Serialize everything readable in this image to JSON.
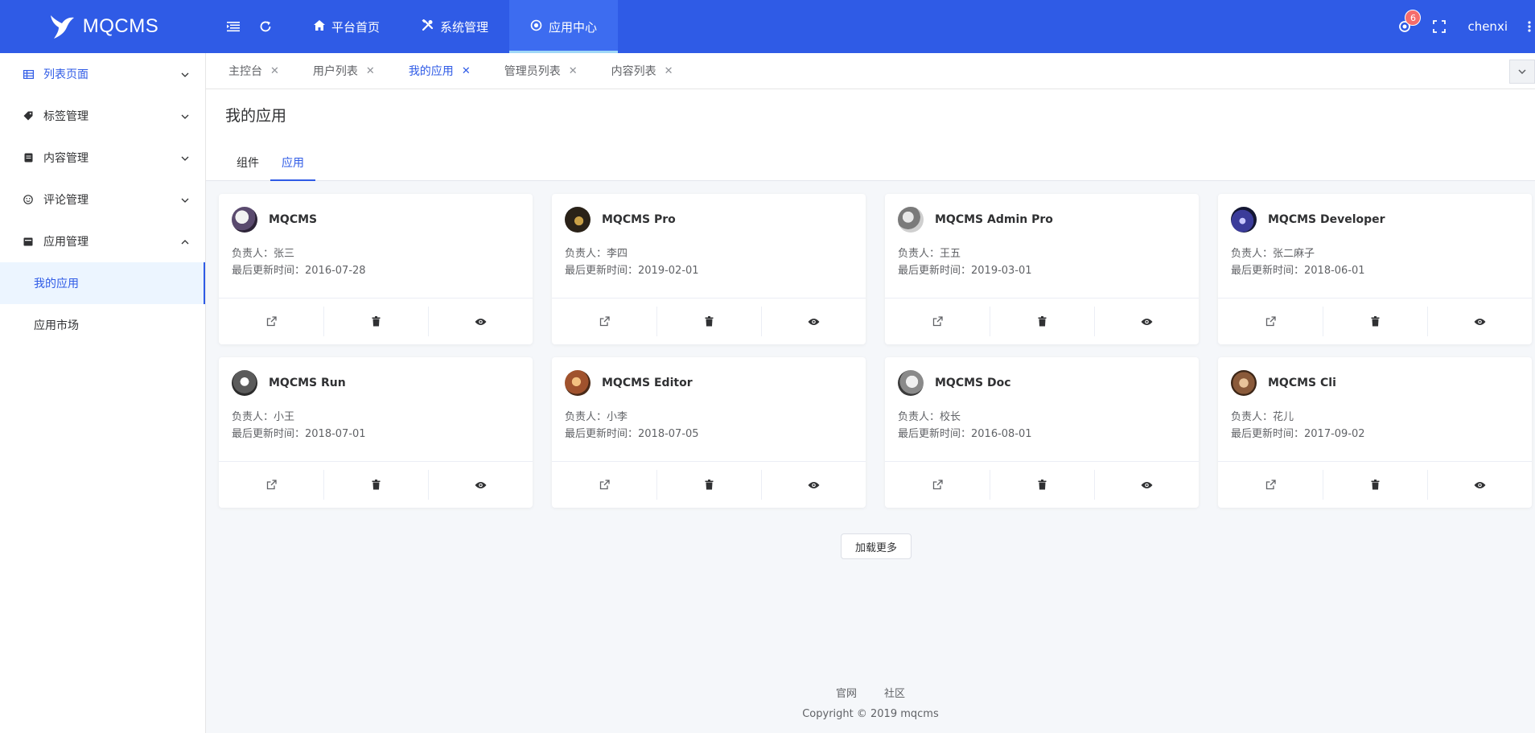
{
  "header": {
    "logo_text": "MQCMS",
    "nav": [
      {
        "label": "平台首页",
        "icon": "home-icon"
      },
      {
        "label": "系统管理",
        "icon": "tools-icon"
      },
      {
        "label": "应用中心",
        "icon": "target-icon",
        "active": true
      }
    ],
    "notification_count": "6",
    "username": "chenxi"
  },
  "sidebar": {
    "items": [
      {
        "label": "列表页面",
        "icon": "table-icon"
      },
      {
        "label": "标签管理",
        "icon": "tag-icon"
      },
      {
        "label": "内容管理",
        "icon": "document-icon"
      },
      {
        "label": "评论管理",
        "icon": "smile-icon"
      },
      {
        "label": "应用管理",
        "icon": "app-icon"
      }
    ],
    "subitems": [
      {
        "label": "我的应用",
        "active": true
      },
      {
        "label": "应用市场"
      }
    ]
  },
  "tabs": [
    {
      "label": "主控台"
    },
    {
      "label": "用户列表"
    },
    {
      "label": "我的应用",
      "active": true
    },
    {
      "label": "管理员列表"
    },
    {
      "label": "内容列表"
    }
  ],
  "page": {
    "title": "我的应用",
    "subtabs": [
      {
        "label": "组件"
      },
      {
        "label": "应用",
        "active": true
      }
    ],
    "owner_prefix": "负责人：",
    "updated_prefix": "最后更新时间："
  },
  "cards": [
    {
      "name": "MQCMS",
      "owner": "张三",
      "updated": "2016-07-28"
    },
    {
      "name": "MQCMS Pro",
      "owner": "李四",
      "updated": "2019-02-01"
    },
    {
      "name": "MQCMS Admin Pro",
      "owner": "王五",
      "updated": "2019-03-01"
    },
    {
      "name": "MQCMS Developer",
      "owner": "张二麻子",
      "updated": "2018-06-01"
    },
    {
      "name": "MQCMS Run",
      "owner": "小王",
      "updated": "2018-07-01"
    },
    {
      "name": "MQCMS Editor",
      "owner": "小李",
      "updated": "2018-07-05"
    },
    {
      "name": "MQCMS Doc",
      "owner": "校长",
      "updated": "2016-08-01"
    },
    {
      "name": "MQCMS Cli",
      "owner": "花儿",
      "updated": "2017-09-02"
    }
  ],
  "load_more": "加载更多",
  "footer": {
    "links": [
      "官网",
      "社区"
    ],
    "copyright": "Copyright © 2019 mqcms"
  },
  "colors": {
    "primary": "#2f5be6",
    "badge": "#f56c6c",
    "background": "#f5f7fa"
  }
}
